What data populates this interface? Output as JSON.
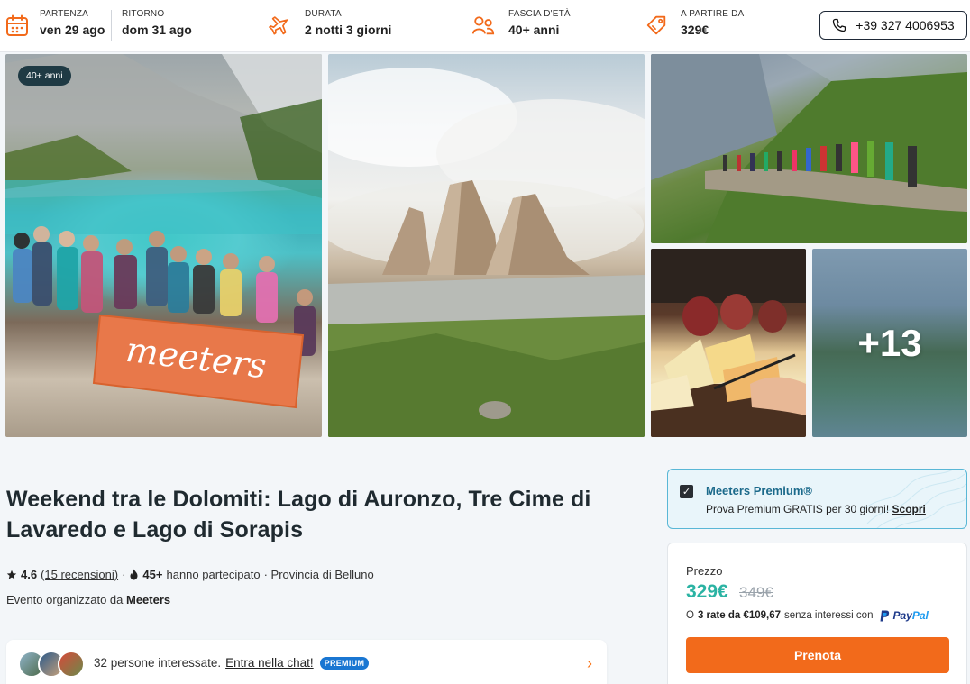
{
  "topbar": {
    "departure": {
      "label": "Partenza",
      "value": "ven 29 ago"
    },
    "return": {
      "label": "Ritorno",
      "value": "dom 31 ago"
    },
    "duration": {
      "label": "Durata",
      "value": "2 notti 3 giorni"
    },
    "age": {
      "label": "Fascia d'età",
      "value": "40+ anni"
    },
    "price": {
      "label": "A partire da",
      "value": "329€"
    },
    "phone": "+39 327 4006953",
    "accent_color": "#f26a1b"
  },
  "gallery": {
    "age_badge": "40+ anni",
    "more_photos": "+13",
    "banner_text": "meeters"
  },
  "event": {
    "title": "Weekend tra le Dolomiti: Lago di Auronzo, Tre Cime di Lavaredo e Lago di Sorapis",
    "rating": "4.6",
    "reviews": "(15 recensioni)",
    "participants_count": "45+",
    "participants_text": "hanno partecipato",
    "location": "· Provincia di Belluno",
    "organizer_prefix": "Evento organizzato da",
    "organizer_name": "Meeters"
  },
  "chat": {
    "text": "32 persone interessate.",
    "link": "Entra nella chat!",
    "badge": "PREMIUM"
  },
  "premium": {
    "title": "Meeters Premium®",
    "subtitle": "Prova Premium GRATIS per 30 giorni!",
    "link": "Scopri"
  },
  "price_card": {
    "label": "Prezzo",
    "price": "329€",
    "old_price": "349€",
    "installments_prefix": "O",
    "installments_bold": "3 rate da €109,67",
    "installments_suffix": "senza interessi con",
    "paypal_1": "Pay",
    "paypal_2": "Pal",
    "cta": "Prenota",
    "price_color": "#2bb3a3"
  }
}
